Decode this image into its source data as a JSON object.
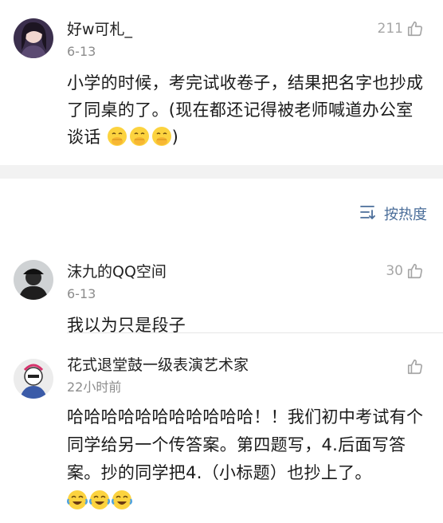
{
  "comments": [
    {
      "username": "好w可札_",
      "date": "6-13",
      "likes": "211",
      "text": "小学的时候，考完试收卷子，结果把名字也抄成了同桌的了。(现在都还记得被老师喊道办公室谈话",
      "emoji_tail": ")"
    },
    {
      "username": "沫九的QQ空间",
      "date": "6-13",
      "likes": "30",
      "text": "我以为只是段子"
    },
    {
      "username": "花式退堂鼓一级表演艺术家",
      "date": "22小时前",
      "likes": "",
      "text": "哈哈哈哈哈哈哈哈哈哈哈！！我们初中考试有个同学给另一个传答案。第四题写，4.后面写答案。抄的同学把4.（小标题）也抄上了。"
    }
  ],
  "sort": {
    "label": "按热度"
  },
  "icons": {
    "like": "thumbs-up-icon",
    "sort": "sort-icon",
    "emoji_1": "face-with-hand-over-mouth-icon",
    "emoji_3": "tears-of-joy-icon"
  },
  "colors": {
    "accent": "#4a6d99",
    "muted": "#a6a6a6",
    "divider": "#f2f2f2"
  }
}
